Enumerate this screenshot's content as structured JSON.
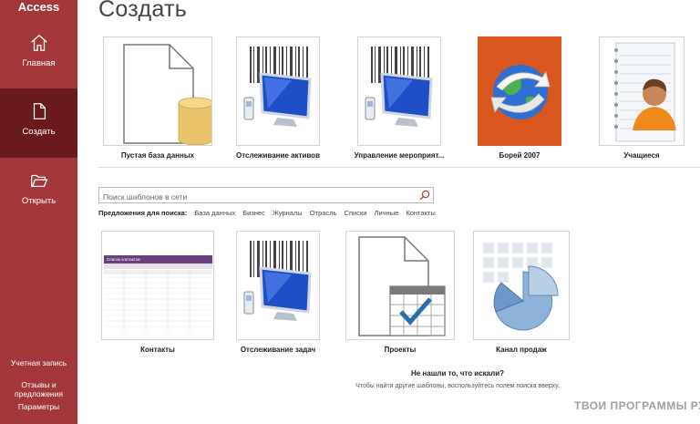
{
  "app": {
    "name": "Access"
  },
  "sidebar": {
    "items": [
      {
        "label": "Главная",
        "icon": "home-icon"
      },
      {
        "label": "Создать",
        "icon": "new-document-icon",
        "active": true
      },
      {
        "label": "Открыть",
        "icon": "open-folder-icon"
      }
    ],
    "bottom": [
      "Учетная запись",
      "Отзывы и предложения",
      "Параметры"
    ],
    "color": "#a4373a",
    "active_color": "#6b1a1c"
  },
  "page": {
    "title": "Создать"
  },
  "featured_templates": [
    {
      "label": "Пустая база данных",
      "thumb": "blank-database"
    },
    {
      "label": "Отслеживание активов",
      "thumb": "computer-barcode"
    },
    {
      "label": "Управление мероприят...",
      "thumb": "computer-barcode"
    },
    {
      "label": "Борей 2007",
      "thumb": "globe-arrows"
    },
    {
      "label": "Учащиеся",
      "thumb": "student-notebook"
    }
  ],
  "search": {
    "placeholder": "Поиск шаблонов в сети",
    "suggestions_label": "Предложения для поиска:",
    "suggestions": [
      "База данных",
      "Бизнес",
      "Журналы",
      "Отрасль",
      "Списки",
      "Личные",
      "Контакты"
    ]
  },
  "other_templates": [
    {
      "label": "Контакты",
      "thumb": "contacts-list",
      "inner_title": "Список контактов"
    },
    {
      "label": "Отслеживание задач",
      "thumb": "computer-barcode"
    },
    {
      "label": "Проекты",
      "thumb": "document-calendar"
    },
    {
      "label": "Канал продаж",
      "thumb": "pie-chart"
    }
  ],
  "not_found": {
    "title": "Не нашли то, что искали?",
    "hint": "Чтобы найти другие шаблоны, воспользуйтесь полем поиска вверху."
  },
  "watermark": "ТВОИ ПРОГРАММЫ РУ"
}
